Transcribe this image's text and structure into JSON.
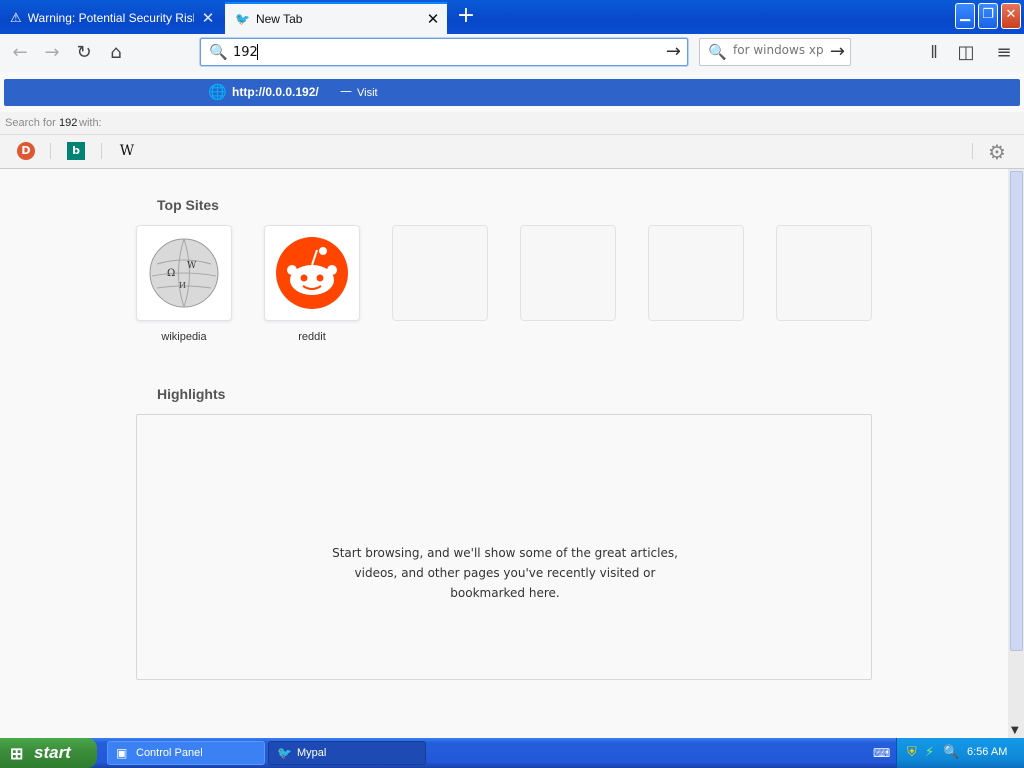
{
  "tabs": [
    {
      "title": "Warning: Potential Security Risk Ahead",
      "icon": "warning-icon",
      "active": false
    },
    {
      "title": "New Tab",
      "icon": "mypal-icon",
      "active": true
    }
  ],
  "navbar": {
    "url_value": "192",
    "search_placeholder": "for windows xp"
  },
  "suggestion": {
    "url": "http://0.0.0.192/",
    "separator": "—",
    "action": "Visit"
  },
  "search_for": {
    "prefix": "Search for",
    "term": "192",
    "suffix": "with:"
  },
  "engines": [
    "duckduckgo-icon",
    "bing-icon",
    "wikipedia-icon"
  ],
  "content": {
    "top_sites_title": "Top Sites",
    "top_sites": [
      {
        "label": "wikipedia"
      },
      {
        "label": "reddit"
      }
    ],
    "highlights_title": "Highlights",
    "highlights_message": "Start browsing, and we'll show some of the great articles, videos, and other pages you've recently visited or bookmarked here."
  },
  "taskbar": {
    "start_label": "start",
    "tasks": [
      {
        "label": "Control Panel"
      },
      {
        "label": "Mypal"
      }
    ],
    "clock": "6:56 AM"
  },
  "colors": {
    "suggestion_bg": "#2e64c9",
    "reddit": "#ff4500",
    "taskbar": "#245edb"
  }
}
